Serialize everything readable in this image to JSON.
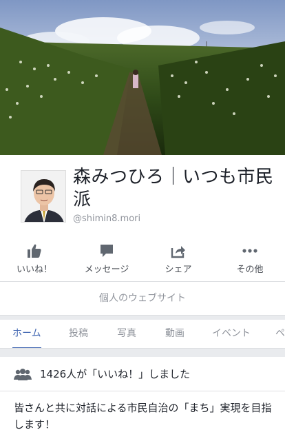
{
  "page": {
    "name": "森みつひろ｜いつも市民派",
    "handle": "@shimin8.mori"
  },
  "actions": [
    {
      "label": "いいね！",
      "icon": "thumbs-up-icon"
    },
    {
      "label": "メッセージ",
      "icon": "message-bubble-icon"
    },
    {
      "label": "シェア",
      "icon": "share-icon"
    },
    {
      "label": "その他",
      "icon": "more-dots-icon"
    }
  ],
  "website_button": "個人のウェブサイト",
  "tabs": [
    {
      "label": "ホーム",
      "active": true
    },
    {
      "label": "投稿",
      "active": false
    },
    {
      "label": "写真",
      "active": false
    },
    {
      "label": "動画",
      "active": false
    },
    {
      "label": "イベント",
      "active": false
    },
    {
      "label": "ペ",
      "active": false
    }
  ],
  "likes_summary": "1426人が「いいね！」しました",
  "about_text": "皆さんと共に対話による市民自治の「まち」実現を目指します！",
  "colors": {
    "accent": "#4267b2",
    "icon_gray": "#606770",
    "muted_text": "#90949c"
  }
}
